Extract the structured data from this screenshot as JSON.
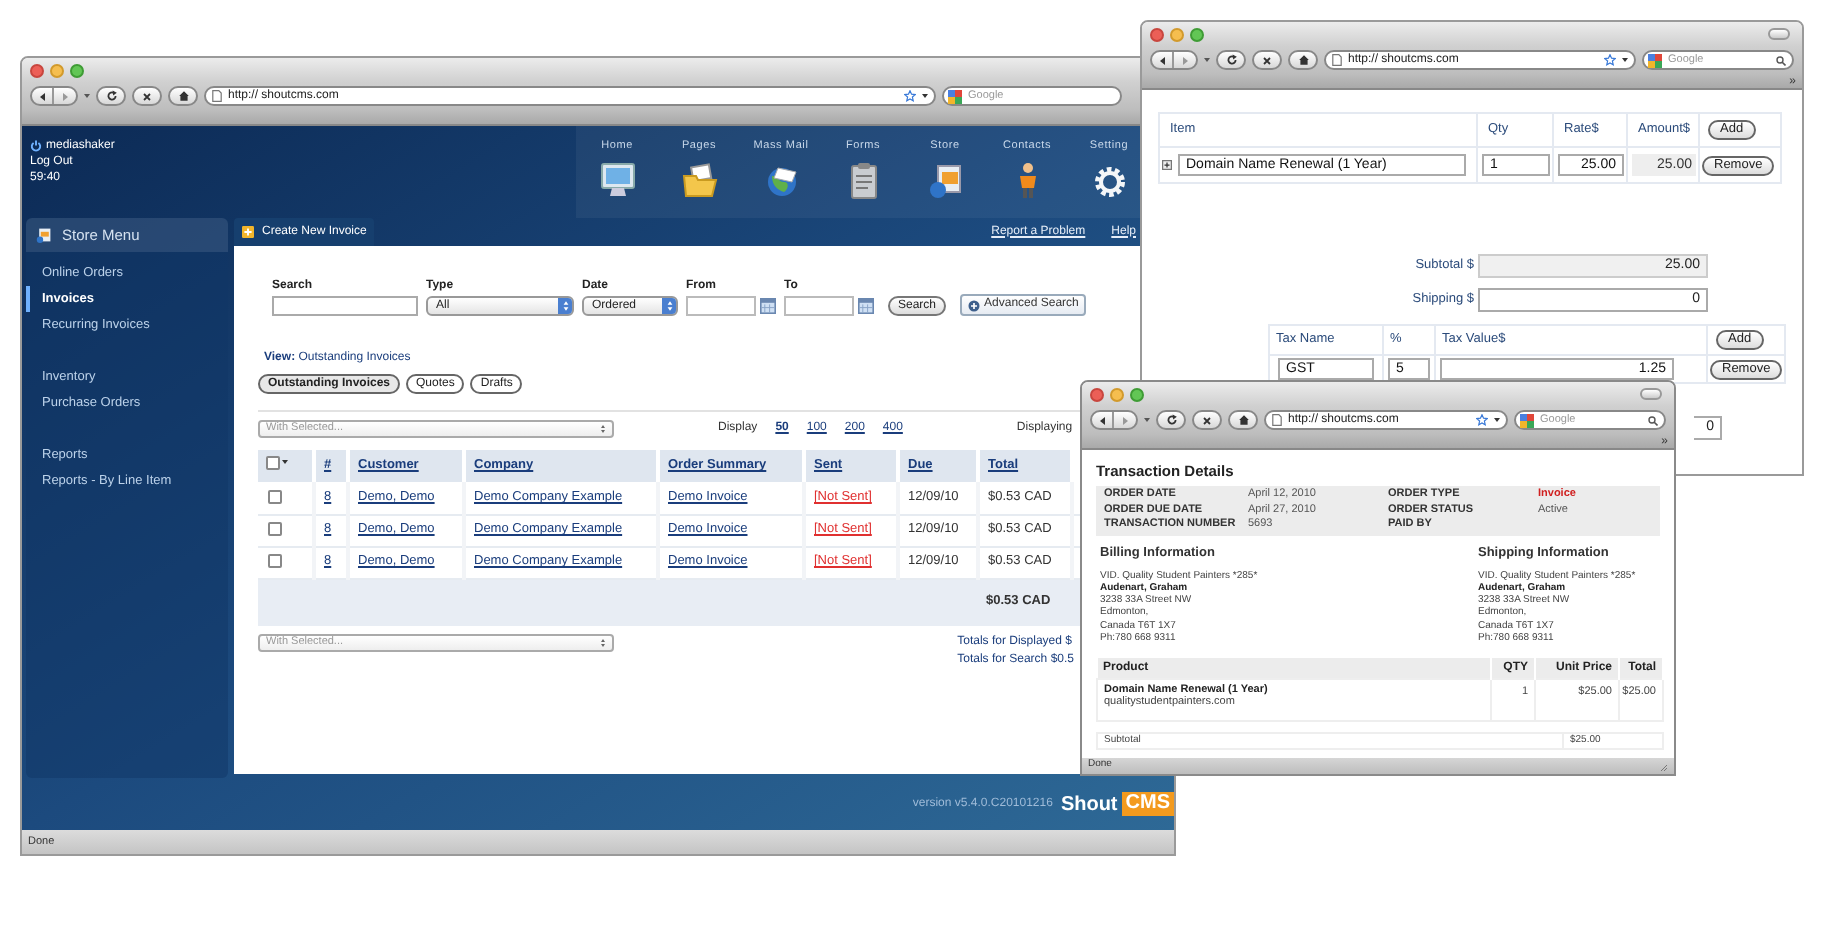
{
  "main_window": {
    "url": "http:// shoutcms.com",
    "search_placeholder": "Google",
    "user": {
      "name": "mediashaker",
      "logout": "Log Out",
      "timer": "59:40"
    },
    "nav": [
      {
        "label": "Home"
      },
      {
        "label": "Pages"
      },
      {
        "label": "Mass Mail"
      },
      {
        "label": "Forms"
      },
      {
        "label": "Store"
      },
      {
        "label": "Contacts"
      },
      {
        "label": "Setting"
      }
    ],
    "sidebar": {
      "title": "Store Menu",
      "groups": [
        [
          {
            "label": "Online Orders",
            "selected": false
          },
          {
            "label": "Invoices",
            "selected": true
          },
          {
            "label": "Recurring Invoices",
            "selected": false
          }
        ],
        [
          {
            "label": "Inventory",
            "selected": false
          },
          {
            "label": "Purchase Orders",
            "selected": false
          }
        ],
        [
          {
            "label": "Reports",
            "selected": false
          },
          {
            "label": "Reports - By Line Item",
            "selected": false
          }
        ]
      ]
    },
    "panel": {
      "title": "Create New Invoice",
      "links": [
        "Report a Problem",
        "Help"
      ],
      "filters": {
        "search_label": "Search",
        "type_label": "Type",
        "type_value": "All",
        "date_label": "Date",
        "date_value": "Ordered",
        "from_label": "From",
        "to_label": "To",
        "search_button": "Search",
        "advanced_button": "Advanced Search"
      },
      "view": "**View:** Outstanding Invoices",
      "view_tabs": [
        {
          "label": "Outstanding Invoices",
          "selected": true
        },
        {
          "label": "Quotes",
          "selected": false
        },
        {
          "label": "Drafts",
          "selected": false
        }
      ],
      "bulk_action_top": "With Selected...",
      "display_label": "Display",
      "page_sizes": [
        {
          "label": "50",
          "selected": true
        },
        {
          "label": "100",
          "selected": false
        },
        {
          "label": "200",
          "selected": false
        },
        {
          "label": "400",
          "selected": false
        }
      ],
      "displaying": "Displaying",
      "table": {
        "select_all_checked": false,
        "columns": [
          "#",
          "Customer",
          "Company",
          "Order Summary",
          "Sent",
          "Due",
          "Total"
        ],
        "rows": [
          {
            "checked": false,
            "number": "8",
            "customer": "Demo, Demo",
            "company": "Demo Company Example",
            "summary": "Demo Invoice",
            "sent": "[Not Sent]",
            "due": "12/09/10",
            "total": "$0.53 CAD"
          },
          {
            "checked": false,
            "number": "8",
            "customer": "Demo, Demo",
            "company": "Demo Company Example",
            "summary": "Demo Invoice",
            "sent": "[Not Sent]",
            "due": "12/09/10",
            "total": "$0.53 CAD"
          },
          {
            "checked": false,
            "number": "8",
            "customer": "Demo, Demo",
            "company": "Demo Company Example",
            "summary": "Demo Invoice",
            "sent": "[Not Sent]",
            "due": "12/09/10",
            "total": "$0.53 CAD"
          }
        ],
        "total": "$0.53 CAD"
      },
      "bulk_action_bottom": "With Selected...",
      "totals": [
        "Totals for Displayed $",
        "Totals for Search $0.5"
      ]
    },
    "footer": {
      "version": "version v5.4.0.C20101216",
      "brand": "Shout",
      "brand_badge": "CMS"
    },
    "status": "Done"
  },
  "editor_window": {
    "url": "http:// shoutcms.com",
    "search_placeholder": "Google",
    "bookmarks_overflow": "»",
    "items": {
      "columns": [
        "Item",
        "Qty",
        "Rate$",
        "Amount$"
      ],
      "add_button": "Add",
      "rows": [
        {
          "name": "Domain Name Renewal (1 Year)",
          "qty": "1",
          "rate": "25.00",
          "amount": "25.00",
          "remove_button": "Remove"
        }
      ]
    },
    "subtotal_label": "Subtotal $",
    "subtotal": "25.00",
    "shipping_label": "Shipping $",
    "shipping": "0",
    "taxes": {
      "columns": [
        "Tax Name",
        "%",
        "Tax Value$"
      ],
      "add_button": "Add",
      "rows": [
        {
          "name": "GST",
          "rate": "5",
          "value": "1.25",
          "remove_button": "Remove"
        }
      ]
    },
    "total": "0"
  },
  "transaction_window": {
    "url": "http:// shoutcms.com",
    "search_placeholder": "Google",
    "bookmarks_overflow": "»",
    "title": "Transaction Details",
    "details": [
      {
        "label": "ORDER DATE",
        "value": "April 12, 2010",
        "highlight": false
      },
      {
        "label": "ORDER TYPE",
        "value": "Invoice",
        "highlight": true
      },
      {
        "label": "ORDER DUE DATE",
        "value": "April 27, 2010",
        "highlight": false
      },
      {
        "label": "ORDER STATUS",
        "value": "Active",
        "highlight": false
      },
      {
        "label": "TRANSACTION NUMBER",
        "value": "5693",
        "highlight": false
      },
      {
        "label": "PAID BY"
      }
    ],
    "addresses": [
      {
        "title": "Billing Information",
        "company": "VID. Quality Student Painters *285*",
        "name": "Audenart, Graham",
        "lines": [
          "3238 33A Street NW",
          "Edmonton,",
          "Canada T6T 1X7",
          "Ph:780 668 9311"
        ]
      },
      {
        "title": "Shipping Information",
        "company": "VID. Quality Student Painters *285*",
        "name": "Audenart, Graham",
        "lines": [
          "3238 33A Street NW",
          "Edmonton,",
          "Canada T6T 1X7",
          "Ph:780 668 9311"
        ]
      }
    ],
    "products": {
      "columns": [
        "Product",
        "QTY",
        "Unit Price",
        "Total"
      ],
      "rows": [
        {
          "name": "Domain Name Renewal (1 Year)",
          "site": "qualitystudentpainters.com",
          "qty": "1",
          "price": "$25.00",
          "total": "$25.00"
        }
      ]
    },
    "subtotal_label": "Subtotal",
    "subtotal": "$25.00",
    "status": "Done"
  }
}
